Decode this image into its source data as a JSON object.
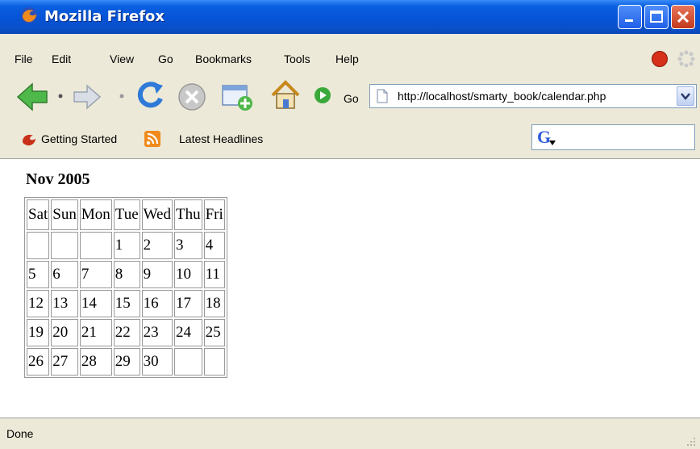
{
  "window": {
    "title": "Mozilla Firefox"
  },
  "menu": {
    "items": [
      "File",
      "Edit",
      "View",
      "Go",
      "Bookmarks",
      "Tools",
      "Help"
    ]
  },
  "nav": {
    "go_label": "Go",
    "url": "http://localhost/smarty_book/calendar.php"
  },
  "bookmarks": {
    "items": [
      "Getting Started",
      "Latest Headlines"
    ],
    "search_logo": "G"
  },
  "page": {
    "heading": "Nov 2005",
    "calendar": {
      "headers": [
        "Sat",
        "Sun",
        "Mon",
        "Tue",
        "Wed",
        "Thu",
        "Fri"
      ],
      "rows": [
        [
          "",
          "",
          "",
          "1",
          "2",
          "3",
          "4"
        ],
        [
          "5",
          "6",
          "7",
          "8",
          "9",
          "10",
          "11"
        ],
        [
          "12",
          "13",
          "14",
          "15",
          "16",
          "17",
          "18"
        ],
        [
          "19",
          "20",
          "21",
          "22",
          "23",
          "24",
          "25"
        ],
        [
          "26",
          "27",
          "28",
          "29",
          "30",
          "",
          ""
        ]
      ]
    }
  },
  "status": {
    "text": "Done"
  },
  "colors": {
    "titlebar": "#0553d6",
    "chrome": "#ece9d8",
    "accent_green": "#3aa83a"
  }
}
